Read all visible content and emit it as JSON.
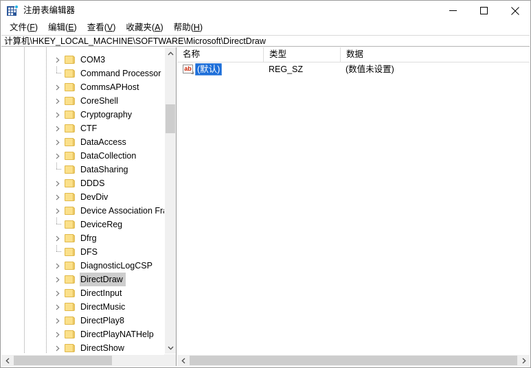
{
  "window": {
    "title": "注册表编辑器",
    "icon": "registry-editor-icon",
    "minimize_label": "最小化",
    "maximize_label": "最大化",
    "close_label": "关闭"
  },
  "menubar": {
    "items": [
      {
        "label": "文件",
        "pre": "文件",
        "accel": "F"
      },
      {
        "label": "编辑",
        "pre": "编辑",
        "accel": "E"
      },
      {
        "label": "查看",
        "pre": "查看",
        "accel": "V"
      },
      {
        "label": "收藏夹",
        "pre": "收藏夹",
        "accel": "A"
      },
      {
        "label": "帮助",
        "pre": "帮助",
        "accel": "H"
      }
    ]
  },
  "address": {
    "path": "计算机\\HKEY_LOCAL_MACHINE\\SOFTWARE\\Microsoft\\DirectDraw"
  },
  "tree": {
    "items": [
      {
        "label": "COM3",
        "expandable": true,
        "selected": false
      },
      {
        "label": "Command Processor",
        "expandable": false,
        "selected": false
      },
      {
        "label": "CommsAPHost",
        "expandable": true,
        "selected": false
      },
      {
        "label": "CoreShell",
        "expandable": true,
        "selected": false
      },
      {
        "label": "Cryptography",
        "expandable": true,
        "selected": false
      },
      {
        "label": "CTF",
        "expandable": true,
        "selected": false
      },
      {
        "label": "DataAccess",
        "expandable": true,
        "selected": false
      },
      {
        "label": "DataCollection",
        "expandable": true,
        "selected": false
      },
      {
        "label": "DataSharing",
        "expandable": false,
        "selected": false
      },
      {
        "label": "DDDS",
        "expandable": true,
        "selected": false
      },
      {
        "label": "DevDiv",
        "expandable": true,
        "selected": false
      },
      {
        "label": "Device Association Fra",
        "expandable": true,
        "selected": false
      },
      {
        "label": "DeviceReg",
        "expandable": false,
        "selected": false
      },
      {
        "label": "Dfrg",
        "expandable": true,
        "selected": false
      },
      {
        "label": "DFS",
        "expandable": false,
        "selected": false
      },
      {
        "label": "DiagnosticLogCSP",
        "expandable": true,
        "selected": false
      },
      {
        "label": "DirectDraw",
        "expandable": true,
        "selected": true
      },
      {
        "label": "DirectInput",
        "expandable": true,
        "selected": false
      },
      {
        "label": "DirectMusic",
        "expandable": true,
        "selected": false
      },
      {
        "label": "DirectPlay8",
        "expandable": true,
        "selected": false
      },
      {
        "label": "DirectPlayNATHelp",
        "expandable": true,
        "selected": false
      },
      {
        "label": "DirectShow",
        "expandable": true,
        "selected": false
      }
    ]
  },
  "list": {
    "columns": [
      {
        "label": "名称",
        "key": "name"
      },
      {
        "label": "类型",
        "key": "type"
      },
      {
        "label": "数据",
        "key": "data"
      }
    ],
    "rows": [
      {
        "name": "(默认)",
        "type": "REG_SZ",
        "data": "(数值未设置)",
        "icon": "string-value-icon",
        "selected": true
      }
    ]
  },
  "colors": {
    "selection_blue": "#1e6fd9",
    "tree_selection_gray": "#cdcdcd",
    "folder_yellow": "#fbe08a",
    "scrollbar_thumb": "#cdcdcd",
    "app_icon_blue": "#2b579a"
  }
}
